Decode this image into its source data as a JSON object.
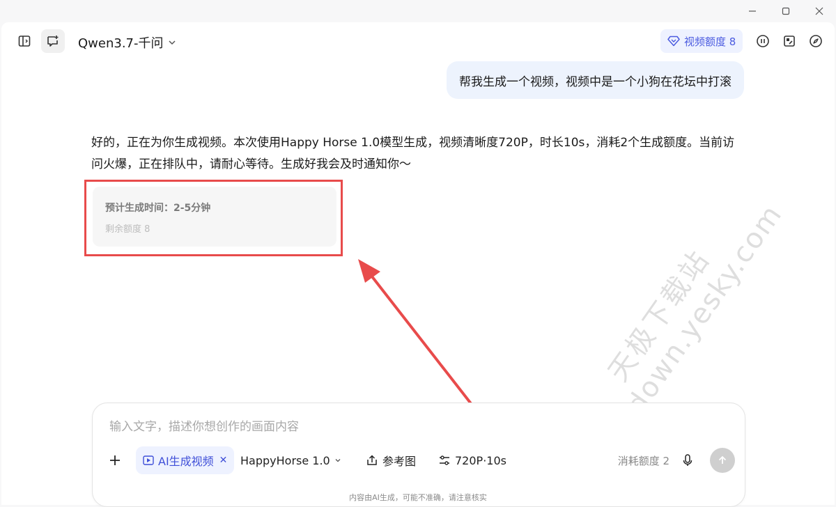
{
  "header": {
    "model_name": "Qwen3.7-千问",
    "quota_label": "视频额度 8"
  },
  "conversation": {
    "user_message": "帮我生成一个视频，视频中是一个小狗在花坛中打滚",
    "assistant_reply": "好的，正在为你生成视频。本次使用Happy Horse 1.0模型生成，视频清晰度720P，时长10s，消耗2个生成额度。当前访问火爆，正在排队中，请耐心等待。生成好我会及时通知你～",
    "status_card": {
      "title": "预计生成时间：2-5分钟",
      "remaining": "剩余额度 8"
    }
  },
  "watermark": {
    "line1": "天极下载站",
    "line2": "mydown.yesky.com"
  },
  "composer": {
    "placeholder": "输入文字，描述你想创作的画面内容",
    "mode_chip": "AI生成视频",
    "model_select": "HappyHorse 1.0",
    "reference_label": "参考图",
    "settings_label": "720P·10s",
    "consume_label": "消耗额度 2"
  },
  "footer": {
    "disclaimer": "内容由AI生成，可能不准确，请注意核实"
  },
  "colors": {
    "accent": "#4b5be0",
    "highlight": "#e84b4b",
    "bubble": "#edf3fd"
  }
}
